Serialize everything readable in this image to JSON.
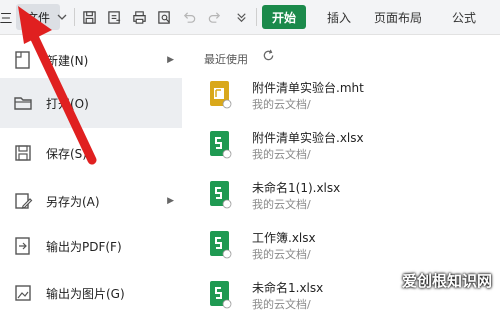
{
  "toolbar": {
    "menu_glyph": "三",
    "file_label": "文件",
    "tabs": [
      {
        "label": "开始",
        "active": true
      },
      {
        "label": "插入"
      },
      {
        "label": "页面布局"
      },
      {
        "label": "公式"
      }
    ],
    "accent": "#1b8a4b"
  },
  "menu": {
    "items": [
      {
        "label": "新建(N)",
        "icon": "new-doc-icon",
        "arrow": true
      },
      {
        "label": "打开(O)",
        "icon": "folder-icon",
        "selected": true
      },
      {
        "label": "保存(S)",
        "icon": "save-icon"
      },
      {
        "label": "另存为(A)",
        "icon": "save-as-icon",
        "arrow": true
      },
      {
        "label": "输出为PDF(F)",
        "icon": "export-pdf-icon"
      },
      {
        "label": "输出为图片(G)",
        "icon": "export-image-icon"
      }
    ]
  },
  "recent": {
    "title": "最近使用",
    "files": [
      {
        "name": "附件清单实验台.mht",
        "path": "我的云文档/",
        "type": "mht"
      },
      {
        "name": "附件清单实验台.xlsx",
        "path": "我的云文档/",
        "type": "xlsx"
      },
      {
        "name": "未命名1(1).xlsx",
        "path": "我的云文档/",
        "type": "xlsx"
      },
      {
        "name": "工作簿.xlsx",
        "path": "我的云文档/",
        "type": "xlsx"
      },
      {
        "name": "未命名1.xlsx",
        "path": "我的云文档/",
        "type": "xlsx"
      }
    ]
  },
  "watermark": "爱创根知识网"
}
